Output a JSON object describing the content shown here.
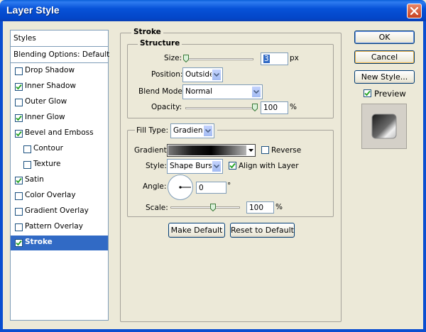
{
  "window": {
    "title": "Layer Style"
  },
  "styles_list": {
    "items": [
      {
        "label": "Styles",
        "type": "header"
      },
      {
        "label": "Blending Options: Default",
        "type": "header"
      },
      {
        "label": "Drop Shadow",
        "checked": false
      },
      {
        "label": "Inner Shadow",
        "checked": true
      },
      {
        "label": "Outer Glow",
        "checked": false
      },
      {
        "label": "Inner Glow",
        "checked": true
      },
      {
        "label": "Bevel and Emboss",
        "checked": true
      },
      {
        "label": "Contour",
        "checked": false,
        "sub": true
      },
      {
        "label": "Texture",
        "checked": false,
        "sub": true
      },
      {
        "label": "Satin",
        "checked": true
      },
      {
        "label": "Color Overlay",
        "checked": false
      },
      {
        "label": "Gradient Overlay",
        "checked": false
      },
      {
        "label": "Pattern Overlay",
        "checked": false
      },
      {
        "label": "Stroke",
        "checked": true,
        "selected": true
      }
    ]
  },
  "stroke": {
    "title": "Stroke",
    "structure": {
      "title": "Structure",
      "size_label": "Size:",
      "size_value": "3",
      "size_unit": "px",
      "position_label": "Position:",
      "position_value": "Outside",
      "blend_mode_label": "Blend Mode:",
      "blend_mode_value": "Normal",
      "opacity_label": "Opacity:",
      "opacity_value": "100",
      "opacity_unit": "%"
    },
    "fill": {
      "fill_type_label": "Fill Type:",
      "fill_type_value": "Gradient",
      "gradient_label": "Gradient:",
      "reverse_label": "Reverse",
      "reverse_checked": false,
      "style_label": "Style:",
      "style_value": "Shape Burst",
      "align_label": "Align with Layer",
      "align_checked": true,
      "angle_label": "Angle:",
      "angle_value": "0",
      "angle_unit": "°",
      "scale_label": "Scale:",
      "scale_value": "100",
      "scale_unit": "%"
    },
    "make_default_label": "Make Default",
    "reset_default_label": "Reset to Default"
  },
  "actions": {
    "ok_label": "OK",
    "cancel_label": "Cancel",
    "new_style_label": "New Style...",
    "preview_label": "Preview",
    "preview_checked": true
  },
  "colors": {
    "titlebar": "#0a4ed0",
    "selection": "#316ac5",
    "dialog_bg": "#ece9d8"
  }
}
